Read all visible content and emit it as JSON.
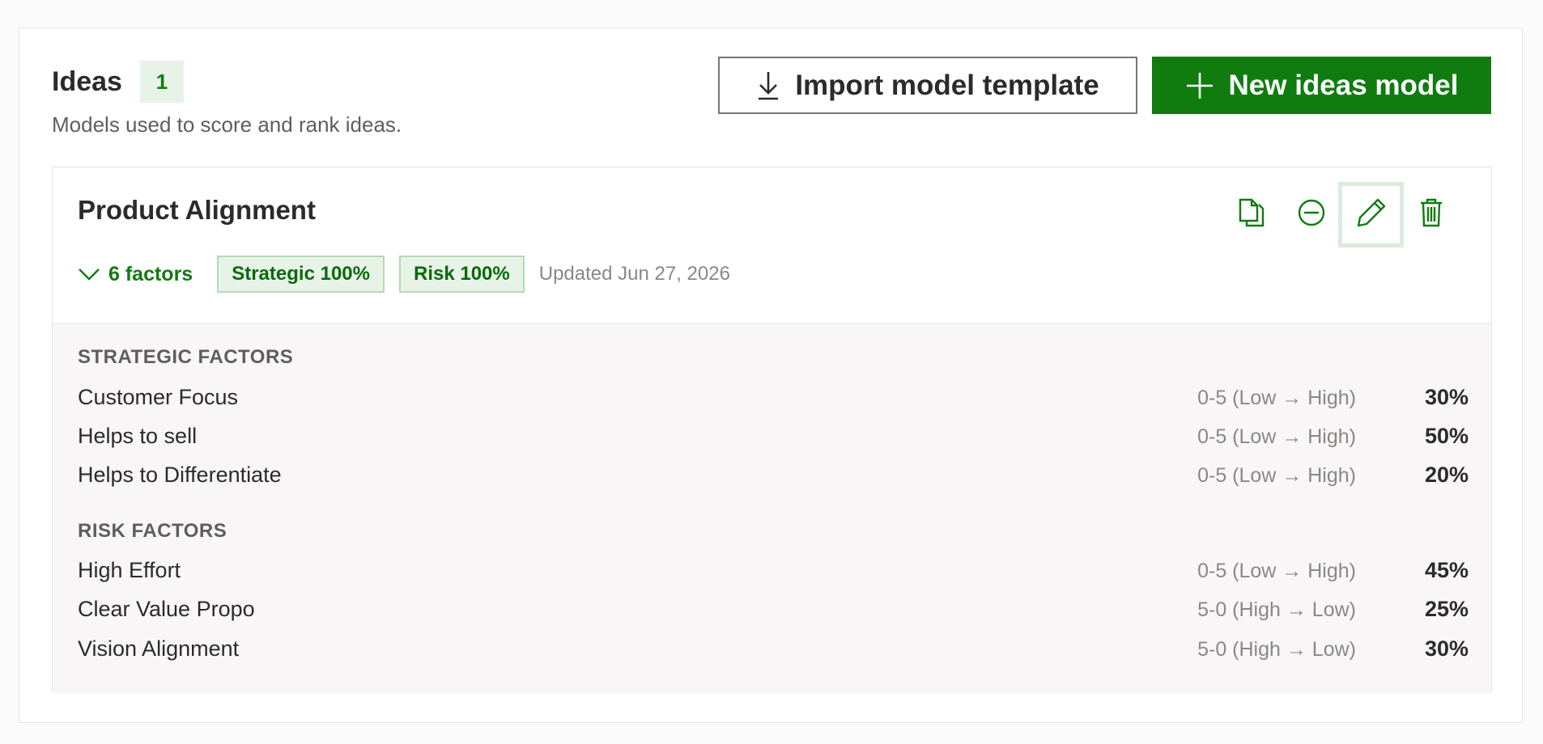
{
  "header": {
    "title": "Ideas",
    "count": "1",
    "subtitle": "Models used to score and rank ideas."
  },
  "buttons": {
    "import_label": "Import model template",
    "new_label": "New ideas model"
  },
  "card": {
    "title": "Product Alignment",
    "factors_toggle": "6 factors",
    "chips": [
      "Strategic 100%",
      "Risk 100%"
    ],
    "updated": "Updated Jun 27, 2026",
    "actions": [
      "copy-icon",
      "disable-icon",
      "edit-icon",
      "delete-icon"
    ]
  },
  "sections": [
    {
      "label": "STRATEGIC FACTORS",
      "rows": [
        {
          "name": "Customer Focus",
          "scale": "0-5 (Low → High)",
          "weight": "30%"
        },
        {
          "name": "Helps to sell",
          "scale": "0-5 (Low → High)",
          "weight": "50%"
        },
        {
          "name": "Helps to Differentiate",
          "scale": "0-5 (Low → High)",
          "weight": "20%"
        }
      ]
    },
    {
      "label": "RISK FACTORS",
      "rows": [
        {
          "name": "High Effort",
          "scale": "0-5 (Low → High)",
          "weight": "45%"
        },
        {
          "name": "Clear Value Propo",
          "scale": "5-0 (High → Low)",
          "weight": "25%"
        },
        {
          "name": "Vision Alignment",
          "scale": "5-0 (High → Low)",
          "weight": "30%"
        }
      ]
    }
  ],
  "colors": {
    "accent": "#107c10",
    "chip_bg": "#e8f3e8",
    "factors_bg": "#f9f6f7"
  }
}
